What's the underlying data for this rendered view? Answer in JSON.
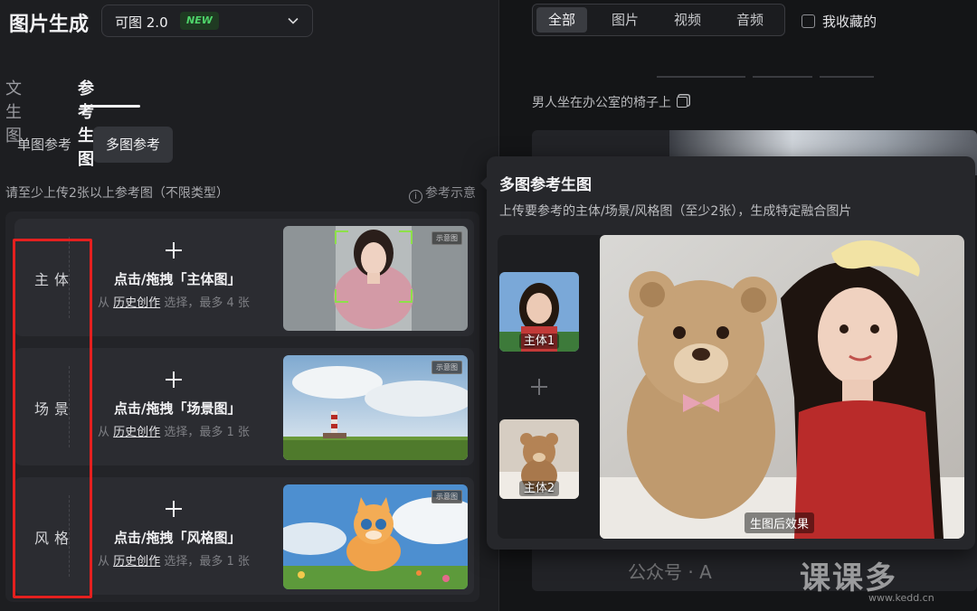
{
  "header": {
    "title": "图片生成",
    "model": "可图 2.0",
    "model_badge": "NEW"
  },
  "tabs": [
    {
      "label": "文生图",
      "active": false
    },
    {
      "label": "参考生图",
      "active": true
    }
  ],
  "modes": [
    {
      "label": "单图参考",
      "active": false
    },
    {
      "label": "多图参考",
      "active": true
    }
  ],
  "upload_hint": "请至少上传2张以上参考图（不限类型）",
  "ref_demo_label": "参考示意",
  "rows": [
    {
      "label": "主体",
      "title": "点击/拖拽「主体图」",
      "from": "从",
      "link": "历史创作",
      "limit": "选择，最多 4 张",
      "demo_tag": "示意图"
    },
    {
      "label": "场景",
      "title": "点击/拖拽「场景图」",
      "from": "从",
      "link": "历史创作",
      "limit": "选择，最多 1 张",
      "demo_tag": "示意图"
    },
    {
      "label": "风格",
      "title": "点击/拖拽「风格图」",
      "from": "从",
      "link": "历史创作",
      "limit": "选择，最多 1 张",
      "demo_tag": "示意图"
    }
  ],
  "filters": [
    {
      "label": "全部",
      "active": true
    },
    {
      "label": "图片",
      "active": false
    },
    {
      "label": "视频",
      "active": false
    },
    {
      "label": "音频",
      "active": false
    }
  ],
  "favorites_label": "我收藏的",
  "result_prompt": "男人坐在办公室的椅子上",
  "popup": {
    "title": "多图参考生图",
    "description": "上传要参考的主体/场景/风格图（至少2张），生成特定融合图片",
    "subject1": "主体1",
    "subject2": "主体2",
    "result_label": "生图后效果"
  },
  "watermark": {
    "text": "公众号 · A",
    "brand": "课课多",
    "url": "www.kedd.cn"
  },
  "colors": {
    "accent_red": "#e4201f",
    "badge_green": "#4ed46a"
  }
}
